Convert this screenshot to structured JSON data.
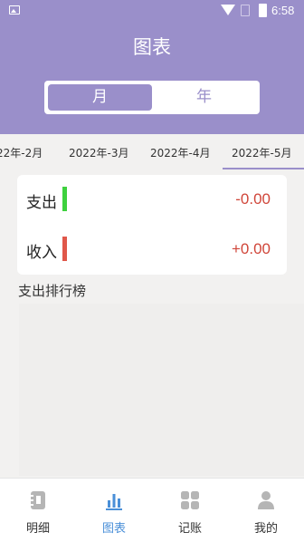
{
  "status_bar": {
    "time": "6:58"
  },
  "header": {
    "title": "图表"
  },
  "segment": {
    "options": [
      "月",
      "年"
    ],
    "selected": "月"
  },
  "months": {
    "items": [
      "22年-2月",
      "2022年-3月",
      "2022年-4月",
      "2022年-5月"
    ],
    "selected": "2022年-5月"
  },
  "summary": {
    "rows": [
      {
        "label": "支出",
        "amount": "-0.00",
        "indicator_color": "#3ed13e",
        "amount_color": "#d0463a"
      },
      {
        "label": "收入",
        "amount": "+0.00",
        "indicator_color": "#e0574a",
        "amount_color": "#d0463a"
      }
    ]
  },
  "ranking": {
    "title": "支出排行榜"
  },
  "colors": {
    "accent": "#9a8fca",
    "tab_active": "#4a8fd8"
  },
  "tabbar": {
    "tabs": [
      {
        "label": "明细",
        "icon": "ledger-icon"
      },
      {
        "label": "图表",
        "icon": "bar-chart-icon"
      },
      {
        "label": "记账",
        "icon": "grid-icon"
      },
      {
        "label": "我的",
        "icon": "user-icon"
      }
    ],
    "selected": "图表"
  }
}
